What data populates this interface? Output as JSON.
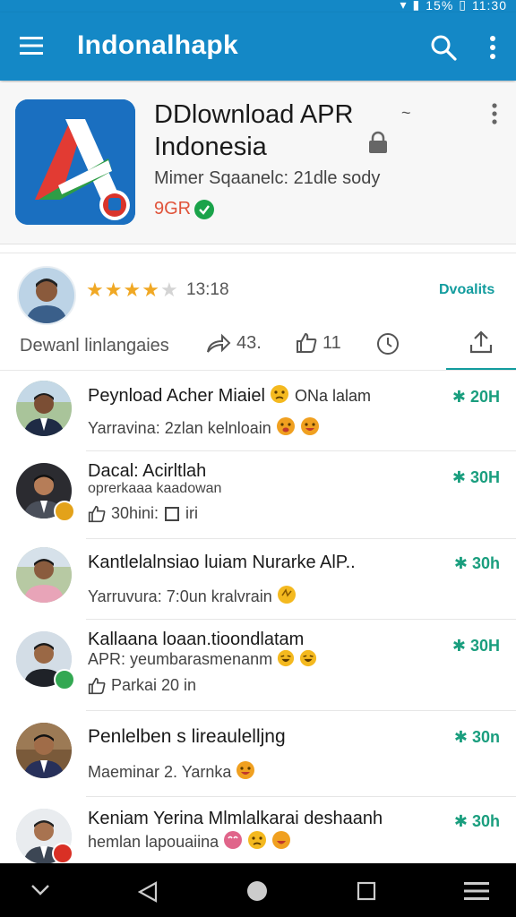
{
  "status_bar": {
    "time": "11:30",
    "battery": "15%"
  },
  "app_bar": {
    "title": "Indonalhapk"
  },
  "app_header": {
    "name_line1": "DDlownload APR",
    "name_line2": "Indonesia",
    "subtitle": "Mimer Sqaanelc: 21dle sody",
    "count": "9GR"
  },
  "review": {
    "rating_value": "13:18",
    "rating": 4,
    "rating_max": 5,
    "downloads_label": "Dvoalits",
    "tab_label": "Dewanl linlangaies",
    "share_count": "43.",
    "like_count": "11"
  },
  "feed": [
    {
      "title": "Peynload Acher Miaiel",
      "title_suffix": "ONa lalam",
      "subtitle": "Yarravina: 2zlan kelnloain",
      "time": "20H",
      "emojis": [
        "angry",
        "smile"
      ]
    },
    {
      "title": "Dacal: Acirltlah",
      "subtitle": "oprerkaaa kaadowan",
      "meta_likes": "30hini:",
      "meta_extra": "iri",
      "time": "30H"
    },
    {
      "title": "Kantlelalnsiao luiam Nurarke AlP..",
      "subtitle": "Yarruvura: 7:0un kralvrain",
      "time": "30h",
      "emojis": [
        "wave"
      ]
    },
    {
      "title": "Kallaana loaan.tioondlatam",
      "subtitle": "APR: yeumbarasmenanm",
      "meta_likes": "Parkai 20 in",
      "time": "30H",
      "emojis": [
        "laugh",
        "laugh"
      ]
    },
    {
      "title": "Penlelben s lireaulelljng",
      "subtitle": "Maeminar 2. Yarnka",
      "time": "30n",
      "emojis": [
        "smile"
      ]
    },
    {
      "title": "Keniam Yerina Mlmlalkarai deshaanh",
      "subtitle": "hemlan lapouaiina",
      "time": "30h",
      "emojis": [
        "love",
        "sad",
        "laugh"
      ]
    }
  ],
  "colors": {
    "primary": "#1488c6",
    "accent": "#129c9e",
    "time_green": "#1a9e7e",
    "star": "#f0a824"
  }
}
